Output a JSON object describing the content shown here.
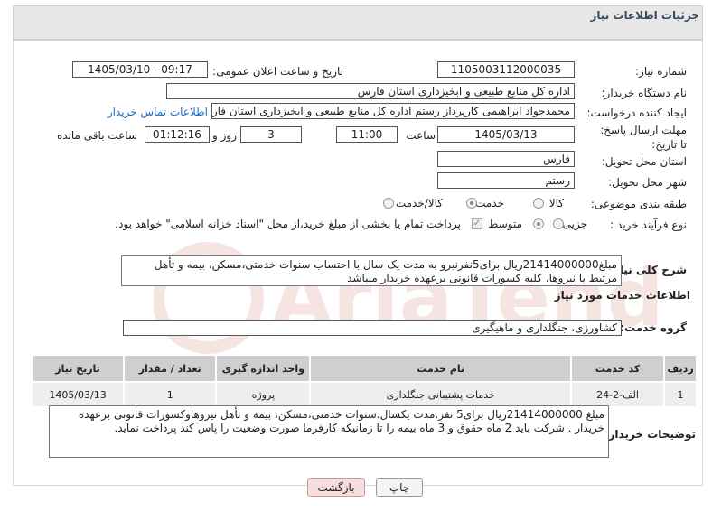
{
  "header": {
    "title": "جزئیات اطلاعات نیاز"
  },
  "fields": {
    "need_number_label": "شماره نیاز:",
    "need_number": "1105003112000035",
    "announce_label": "تاریخ و ساعت اعلان عمومی:",
    "announce_value": "1405/03/10 - 09:17",
    "buyer_org_label": "نام دستگاه خریدار:",
    "buyer_org": "اداره کل منابع طبیعی و ابخیزداری استان فارس",
    "creator_label": "ایجاد کننده درخواست:",
    "creator": "محمدجواد ابراهیمی کارپرداز رستم اداره کل منابع طبیعی و ابخیزداری استان فارس",
    "contact_link": "اطلاعات تماس خریدار",
    "deadline_label": "مهلت ارسال پاسخ: تا تاریخ:",
    "deadline_date": "1405/03/13",
    "time_label": "ساعت",
    "deadline_time": "11:00",
    "days_value": "3",
    "days_label": "روز و",
    "remaining_time": "01:12:16",
    "remaining_label": "ساعت باقی مانده",
    "province_label": "استان محل تحویل:",
    "province": "فارس",
    "city_label": "شهر محل تحویل:",
    "city": "رستم",
    "category_label": "طبقه بندی موضوعی:",
    "category_options": [
      "کالا",
      "خدمت",
      "کالا/خدمت"
    ],
    "category_selected": "خدمت",
    "process_label": "نوع فرآیند خرید :",
    "process_options": [
      "جزیی",
      "متوسط"
    ],
    "process_selected": "متوسط",
    "payment_note": "پرداخت تمام یا بخشی از مبلغ خرید،از محل \"اسناد خزانه اسلامی\" خواهد بود."
  },
  "summary": {
    "label": "شرح کلی نیاز:",
    "text": "مبلغ21414000000ریال برای5نفرنیرو به مدت یک سال با احتساب سنوات خدمتی،مسکن، بیمه و تأهل مرتبط با نیروها. کلیه کسورات قانونی برعهده خریدار میباشد"
  },
  "services": {
    "section_title": "اطلاعات خدمات مورد نیاز",
    "group_label": "گروه خدمت:",
    "group_value": "کشاورزی، جنگلداری و ماهیگیری",
    "columns": [
      "ردیف",
      "کد خدمت",
      "نام خدمت",
      "واحد اندازه گیری",
      "تعداد / مقدار",
      "تاریخ نیاز"
    ],
    "rows": [
      [
        "1",
        "الف-2-24",
        "خدمات پشتیبانی جنگلداری",
        "پروژه",
        "1",
        "1405/03/13"
      ]
    ]
  },
  "buyer_notes": {
    "label": "توضیحات خریدار:",
    "text": "مبلغ 21414000000ریال برای5 نفر.مدت یکسال.سنوات خدمتی،مسکن، بیمه و تأهل نیروهاوکسورات قانونی برعهده خریدار . شرکت باید 2 ماه حقوق و 3 ماه بیمه را تا زمانیکه کارفرما صورت وضعیت را پاس کند پرداخت نماید."
  },
  "buttons": {
    "print": "چاپ",
    "back": "بازگشت"
  },
  "watermark_text": "AriaTender.net"
}
